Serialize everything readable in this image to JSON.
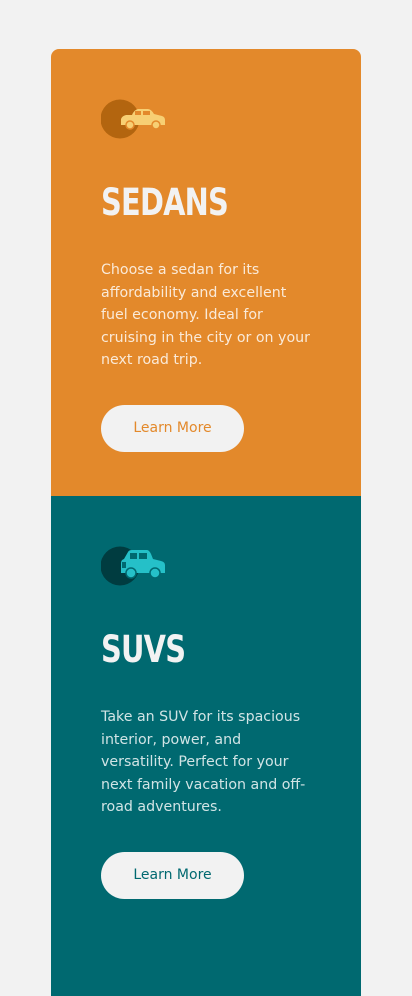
{
  "colors": {
    "page_background": "#f2f2f2",
    "sedans_accent": "#e3892b",
    "suvs_accent": "#006970",
    "text_light": "#f2f2f2"
  },
  "cards": [
    {
      "icon": "sedan-car-icon",
      "title": "SEDANS",
      "description": "Choose a sedan for its affordability and excellent fuel economy. Ideal for cruising in the city or on your next road trip.",
      "button_label": "Learn More"
    },
    {
      "icon": "suv-car-icon",
      "title": "SUVS",
      "description": "Take an SUV for its spacious interior, power, and versatility. Perfect for your next family vacation and off-road adventures.",
      "button_label": "Learn More"
    }
  ]
}
